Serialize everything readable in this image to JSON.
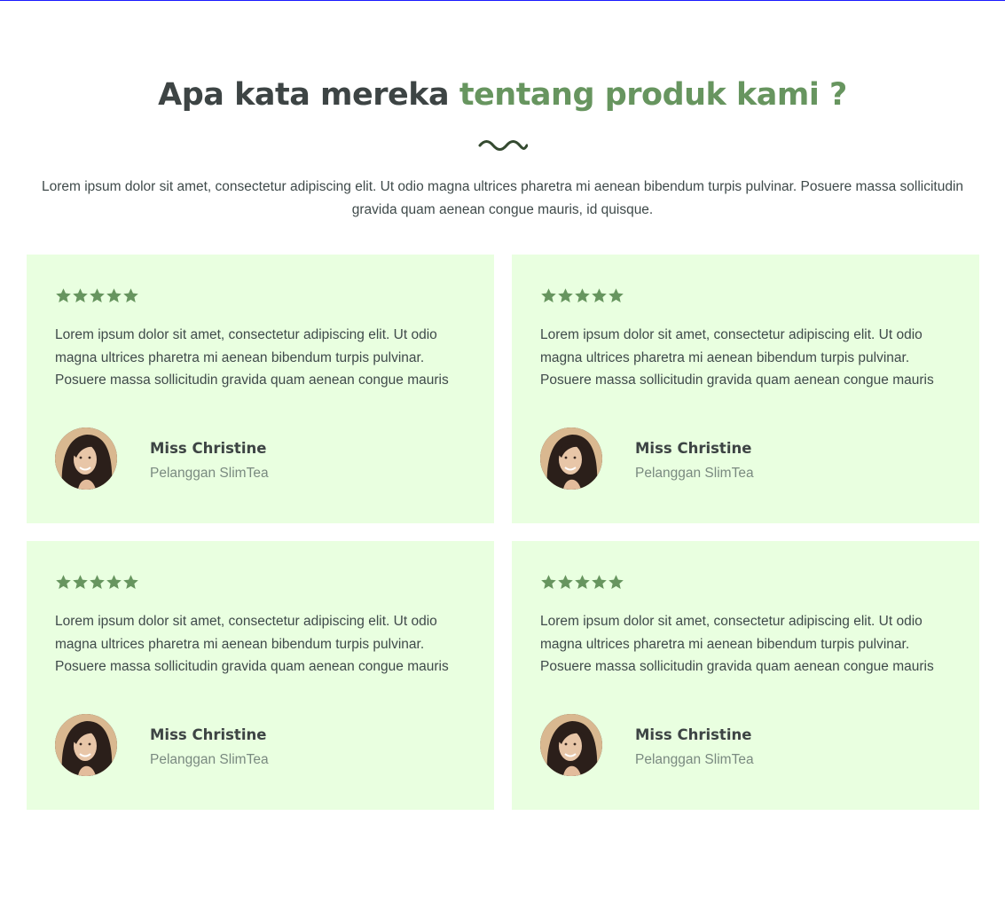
{
  "section": {
    "title_part1": "Apa kata mereka ",
    "title_accent": "tentang produk kami ?",
    "divider_icon": "wave-divider-icon",
    "intro": "Lorem ipsum dolor sit amet, consectetur adipiscing elit. Ut odio magna ultrices pharetra mi aenean bibendum turpis pulvinar. Posuere massa sollicitudin gravida quam aenean congue mauris, id quisque."
  },
  "colors": {
    "accent": "#67955f",
    "heading": "#3d4444",
    "card_background": "#e9ffe0",
    "role_text": "#7a8a80"
  },
  "testimonials": [
    {
      "rating": 5,
      "quote": "Lorem ipsum dolor sit amet, consectetur adipiscing elit. Ut odio magna ultrices pharetra mi aenean bibendum turpis pulvinar. Posuere massa sollicitudin gravida quam aenean congue mauris",
      "name": "Miss Christine",
      "role": "Pelanggan SlimTea",
      "avatar_icon": "avatar-photo"
    },
    {
      "rating": 5,
      "quote": "Lorem ipsum dolor sit amet, consectetur adipiscing elit. Ut odio magna ultrices pharetra mi aenean bibendum turpis pulvinar. Posuere massa sollicitudin gravida quam aenean congue mauris",
      "name": "Miss Christine",
      "role": "Pelanggan SlimTea",
      "avatar_icon": "avatar-photo"
    },
    {
      "rating": 5,
      "quote": "Lorem ipsum dolor sit amet, consectetur adipiscing elit. Ut odio magna ultrices pharetra mi aenean bibendum turpis pulvinar. Posuere massa sollicitudin gravida quam aenean congue mauris",
      "name": "Miss Christine",
      "role": "Pelanggan SlimTea",
      "avatar_icon": "avatar-photo"
    },
    {
      "rating": 5,
      "quote": "Lorem ipsum dolor sit amet, consectetur adipiscing elit. Ut odio magna ultrices pharetra mi aenean bibendum turpis pulvinar. Posuere massa sollicitudin gravida quam aenean congue mauris",
      "name": "Miss Christine",
      "role": "Pelanggan SlimTea",
      "avatar_icon": "avatar-photo"
    }
  ]
}
